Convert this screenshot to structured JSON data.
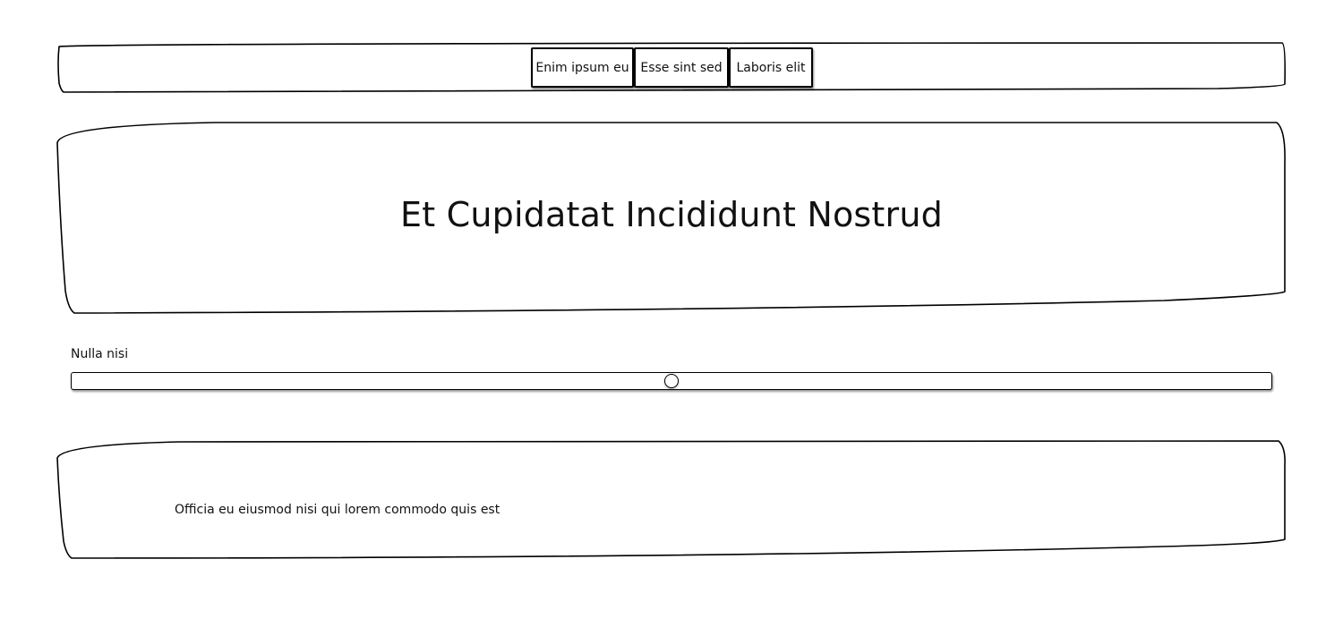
{
  "nav": {
    "items": [
      {
        "label": "Enim ipsum eu"
      },
      {
        "label": "Esse sint sed"
      },
      {
        "label": "Laboris elit"
      }
    ]
  },
  "hero": {
    "title": "Et Cupidatat Incididunt Nostrud"
  },
  "slider": {
    "label": "Nulla nisi",
    "value_percent": 50
  },
  "footer": {
    "text": "Officia eu eiusmod nisi qui lorem commodo quis est"
  },
  "colors": {
    "stroke": "#000000",
    "background": "#ffffff"
  }
}
